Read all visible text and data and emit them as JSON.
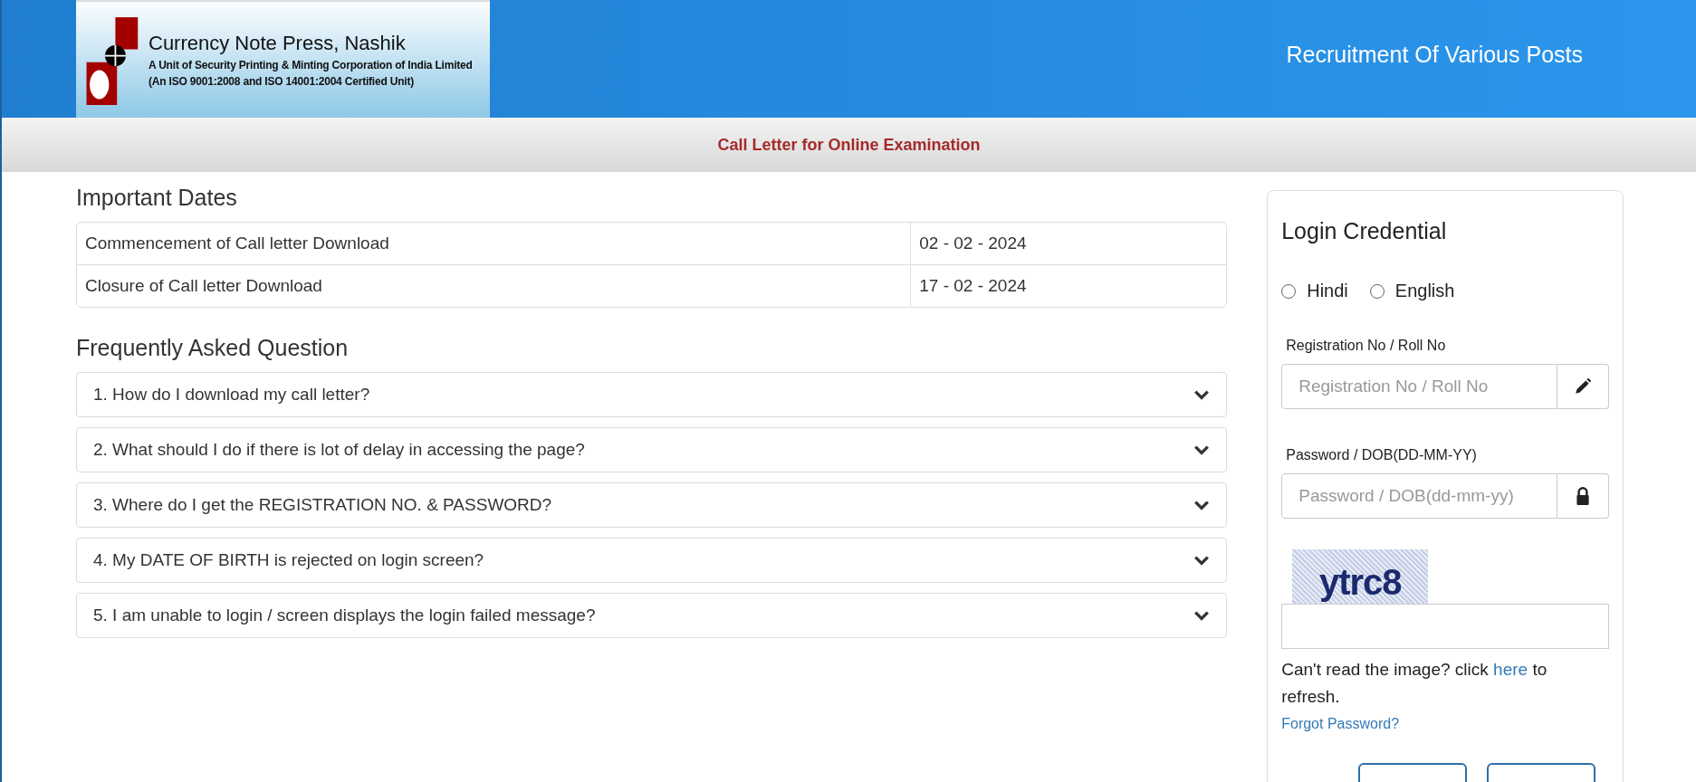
{
  "header": {
    "logo": {
      "title": "Currency Note Press, Nashik",
      "subtitle": "A Unit of Security Printing & Minting Corporation of India Limited",
      "certification": "(An ISO 9001:2008 and ISO 14001:2004 Certified Unit)"
    },
    "title": "Recruitment Of Various Posts"
  },
  "subheader": "Call Letter for Online Examination",
  "important_dates": {
    "heading": "Important Dates",
    "rows": [
      {
        "event": "Commencement of Call letter Download",
        "date": "02 - 02 - 2024"
      },
      {
        "event": "Closure of Call letter Download",
        "date": "17 - 02 - 2024"
      }
    ]
  },
  "faq": {
    "heading": "Frequently Asked Question",
    "items": [
      {
        "question": "1. How do I download my call letter?",
        "expanded": false
      },
      {
        "question": "2. What should I do if there is lot of delay in accessing the page?",
        "expanded": false
      },
      {
        "question": "3. Where do I get the REGISTRATION NO. & PASSWORD?",
        "expanded": false
      },
      {
        "question": "4. My DATE OF BIRTH is rejected on login screen?",
        "expanded": false
      },
      {
        "question": "5. I am unable to login / screen displays the login failed message?",
        "expanded": false
      }
    ]
  },
  "login": {
    "heading": "Login Credential",
    "languages": [
      {
        "label": "Hindi",
        "selected": false
      },
      {
        "label": "English",
        "selected": false
      }
    ],
    "fields": [
      {
        "label": "Registration No / Roll No",
        "placeholder": "Registration No / Roll No",
        "kind": "pencil"
      },
      {
        "label": "Password / DOB(DD-MM-YY)",
        "placeholder": "Password / DOB(dd-mm-yy)",
        "kind": "lock"
      }
    ],
    "captcha": {
      "text": "ytrc8"
    },
    "refresh_note": {
      "before": "Can't read the image? click",
      "link": "here",
      "after": "to refresh."
    },
    "forgot_link": "Forgot Password?"
  }
}
